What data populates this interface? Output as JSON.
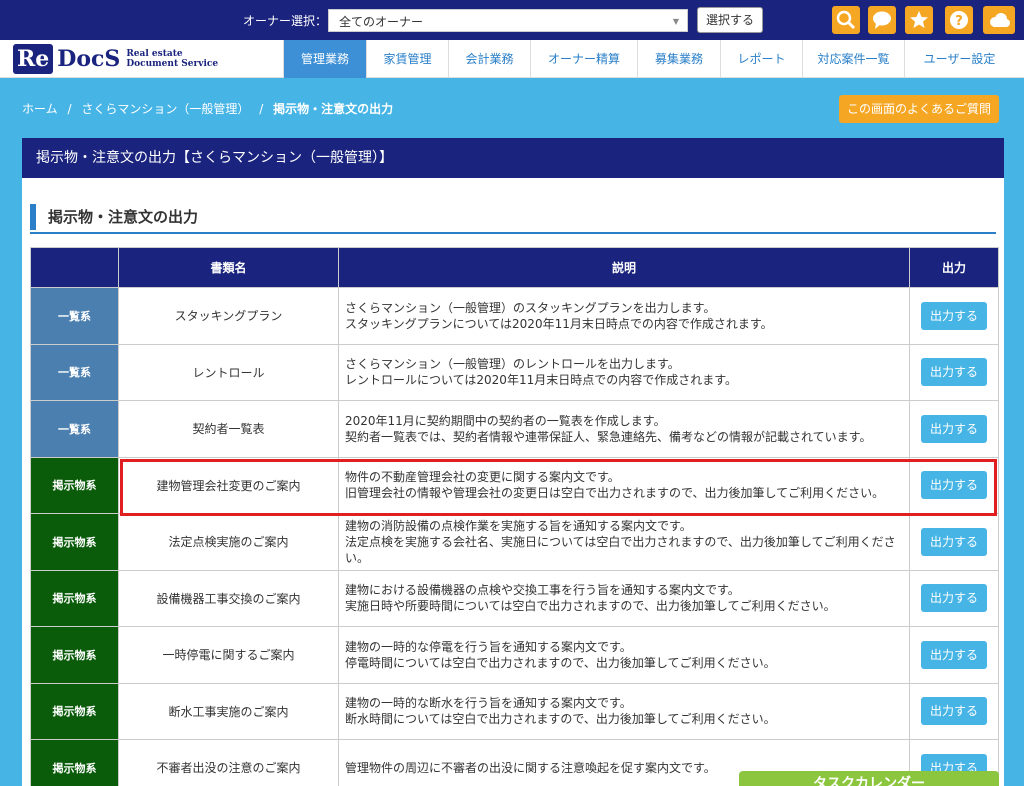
{
  "topbar": {
    "owner_label": "オーナー選択：",
    "owner_value": "全てのオーナー",
    "select_button": "選択する",
    "icons": [
      "search-icon",
      "chat-icon",
      "star-icon",
      "help-icon",
      "cloud-icon"
    ],
    "icon_color": "#f5a623"
  },
  "logo": {
    "re": "Re",
    "docs": "DocS",
    "sub_line1": "Real estate",
    "sub_line2": "Document Service"
  },
  "nav": {
    "items": [
      {
        "label": "管理業務",
        "active": true
      },
      {
        "label": "家賃管理"
      },
      {
        "label": "会計業務"
      },
      {
        "label": "オーナー精算"
      },
      {
        "label": "募集業務"
      },
      {
        "label": "レポート"
      },
      {
        "label": "対応案件一覧"
      },
      {
        "label": "ユーザー設定"
      }
    ]
  },
  "breadcrumb": {
    "home": "ホーム",
    "sep1": "/",
    "property": "さくらマンション（一般管理）",
    "sep2": "/",
    "current": "掲示物・注意文の出力"
  },
  "faq_button": "この画面のよくあるご質問",
  "panel": {
    "title": "掲示物・注意文の出力【さくらマンション（一般管理）】",
    "section_title": "掲示物・注意文の出力"
  },
  "table": {
    "headers": [
      "",
      "書類名",
      "説明",
      "出力"
    ],
    "output_label": "出力する",
    "rows": [
      {
        "category": "一覧系",
        "type": "list",
        "name": "スタッキングプラン",
        "desc1": "さくらマンション（一般管理）のスタッキングプランを出力します。",
        "desc2": "スタッキングプランについては2020年11月末日時点での内容で作成されます。"
      },
      {
        "category": "一覧系",
        "type": "list",
        "name": "レントロール",
        "desc1": "さくらマンション（一般管理）のレントロールを出力します。",
        "desc2": "レントロールについては2020年11月末日時点での内容で作成されます。"
      },
      {
        "category": "一覧系",
        "type": "list",
        "name": "契約者一覧表",
        "desc1": "2020年11月に契約期間中の契約者の一覧表を作成します。",
        "desc2": "契約者一覧表では、契約者情報や連帯保証人、緊急連絡先、備考などの情報が記載されています。"
      },
      {
        "category": "掲示物系",
        "type": "post",
        "name": "建物管理会社変更のご案内",
        "desc1": "物件の不動産管理会社の変更に関する案内文です。",
        "desc2": "旧管理会社の情報や管理会社の変更日は空白で出力されますので、出力後加筆してご利用ください。"
      },
      {
        "category": "掲示物系",
        "type": "post",
        "name": "法定点検実施のご案内",
        "desc1": "建物の消防設備の点検作業を実施する旨を通知する案内文です。",
        "desc2": "法定点検を実施する会社名、実施日については空白で出力されますので、出力後加筆してご利用ください。"
      },
      {
        "category": "掲示物系",
        "type": "post",
        "name": "設備機器工事交換のご案内",
        "desc1": "建物における設備機器の点検や交換工事を行う旨を通知する案内文です。",
        "desc2": "実施日時や所要時間については空白で出力されますので、出力後加筆してご利用ください。"
      },
      {
        "category": "掲示物系",
        "type": "post",
        "name": "一時停電に関するご案内",
        "desc1": "建物の一時的な停電を行う旨を通知する案内文です。",
        "desc2": "停電時間については空白で出力されますので、出力後加筆してご利用ください。"
      },
      {
        "category": "掲示物系",
        "type": "post",
        "name": "断水工事実施のご案内",
        "desc1": "建物の一時的な断水を行う旨を通知する案内文です。",
        "desc2": "断水時間については空白で出力されますので、出力後加筆してご利用ください。"
      },
      {
        "category": "掲示物系",
        "type": "post",
        "name": "不審者出没の注意のご案内",
        "desc1": "管理物件の周辺に不審者の出没に関する注意喚起を促す案内文です。",
        "desc2": ""
      }
    ]
  },
  "task_calendar": "タスクカレンダー",
  "colors": {
    "navy": "#1a237e",
    "sky": "#47b4e6",
    "orange": "#f5a623",
    "list_category": "#4a7fb0",
    "post_category": "#0a5c0a",
    "highlight": "#e02020",
    "green_tab": "#8cc63f"
  }
}
